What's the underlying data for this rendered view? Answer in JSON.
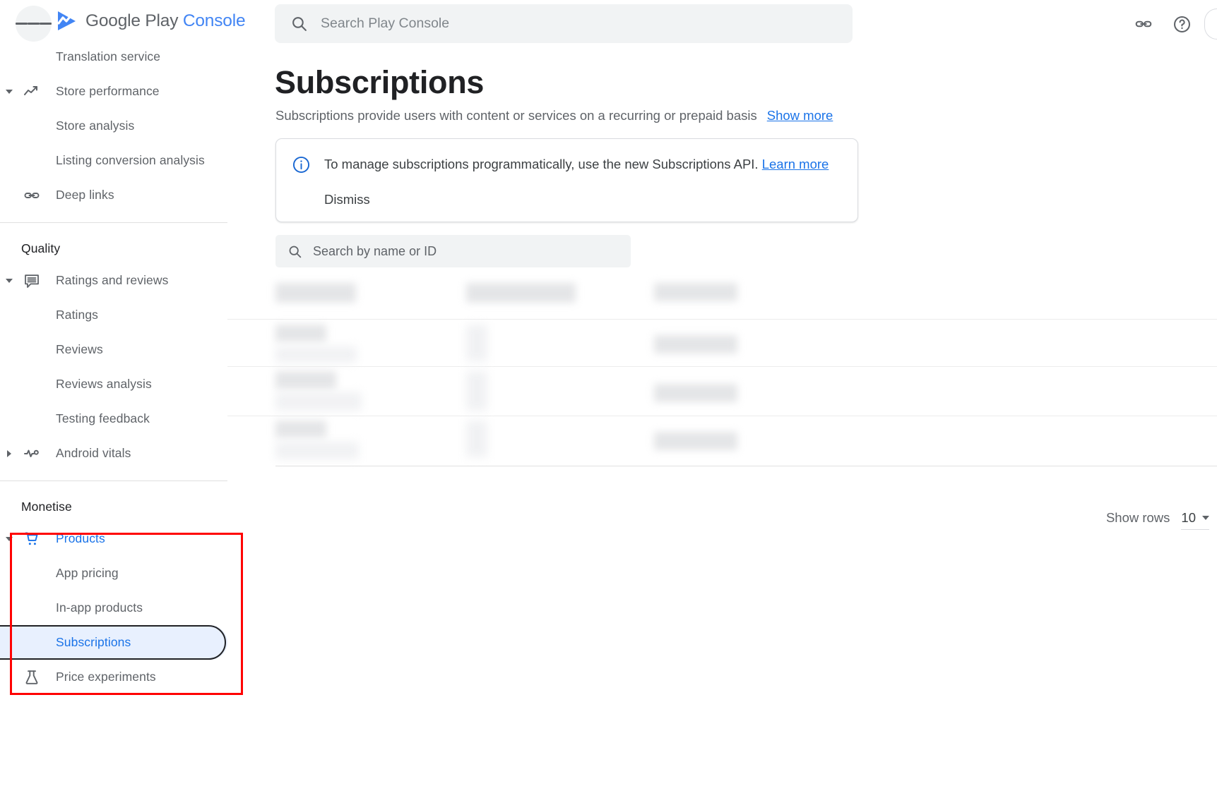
{
  "topbar": {
    "menu_icon": "hamburger-menu-icon",
    "brand_first": "Google Play ",
    "brand_second": "Console",
    "logo_icon": "google-play-console-logo",
    "search": {
      "icon": "search-icon",
      "placeholder": "Search Play Console"
    },
    "actions": [
      {
        "icon": "link-icon",
        "name": "link-icon"
      },
      {
        "icon": "help-icon",
        "name": "help-circle-icon"
      }
    ]
  },
  "sidebar": {
    "items": [
      {
        "label": "Translation service",
        "type": "child",
        "icon": null,
        "arrow": null,
        "state": "normal"
      },
      {
        "label": "Store performance",
        "type": "parent",
        "icon": "trending-up-icon",
        "arrow": "down",
        "state": "normal"
      },
      {
        "label": "Store analysis",
        "type": "child",
        "icon": null,
        "arrow": null,
        "state": "normal"
      },
      {
        "label": "Listing conversion analysis",
        "type": "child",
        "icon": null,
        "arrow": null,
        "state": "normal"
      },
      {
        "label": "Deep links",
        "type": "parent",
        "icon": "link-icon",
        "arrow": null,
        "state": "normal"
      }
    ],
    "quality": {
      "title": "Quality",
      "items": [
        {
          "label": "Ratings and reviews",
          "type": "parent",
          "icon": "reviews-icon",
          "arrow": "down",
          "state": "normal"
        },
        {
          "label": "Ratings",
          "type": "child",
          "icon": null,
          "arrow": null,
          "state": "normal"
        },
        {
          "label": "Reviews",
          "type": "child",
          "icon": null,
          "arrow": null,
          "state": "normal"
        },
        {
          "label": "Reviews analysis",
          "type": "child",
          "icon": null,
          "arrow": null,
          "state": "normal"
        },
        {
          "label": "Testing feedback",
          "type": "child",
          "icon": null,
          "arrow": null,
          "state": "normal"
        },
        {
          "label": "Android vitals",
          "type": "parent",
          "icon": "vitals-pulse-icon",
          "arrow": "right",
          "state": "normal"
        }
      ]
    },
    "monetise": {
      "title": "Monetise",
      "items": [
        {
          "label": "Products",
          "type": "parent",
          "icon": "shopping-cart-icon",
          "arrow": "down",
          "state": "active"
        },
        {
          "label": "App pricing",
          "type": "child",
          "icon": null,
          "arrow": null,
          "state": "normal"
        },
        {
          "label": "In-app products",
          "type": "child",
          "icon": null,
          "arrow": null,
          "state": "normal"
        },
        {
          "label": "Subscriptions",
          "type": "child",
          "icon": null,
          "arrow": null,
          "state": "selected"
        },
        {
          "label": "Price experiments",
          "type": "parent",
          "icon": "flask-icon",
          "arrow": null,
          "state": "normal"
        }
      ]
    }
  },
  "main": {
    "title": "Subscriptions",
    "subtitle": "Subscriptions provide users with content or services on a recurring or prepaid basis",
    "show_more": "Show more",
    "info_banner": {
      "icon": "info-circle-icon",
      "text": "To manage subscriptions programmatically, use the new Subscriptions API.",
      "learn_more": "Learn more",
      "dismiss": "Dismiss"
    },
    "table_search": {
      "icon": "search-icon",
      "placeholder": "Search by name or ID"
    },
    "footer": {
      "show_rows_label": "Show rows",
      "show_rows_value": "10"
    }
  },
  "annotation": {
    "highlight_color": "#ff0000",
    "target": "Products navigation group"
  },
  "colors": {
    "accent_blue": "#1a73e8",
    "brand_blue": "#4285f4",
    "text_primary": "#202124",
    "text_secondary": "#5f6368",
    "selected_bg": "#e8f0fe",
    "field_bg": "#f1f3f4",
    "annotation_red": "#ff0000"
  }
}
